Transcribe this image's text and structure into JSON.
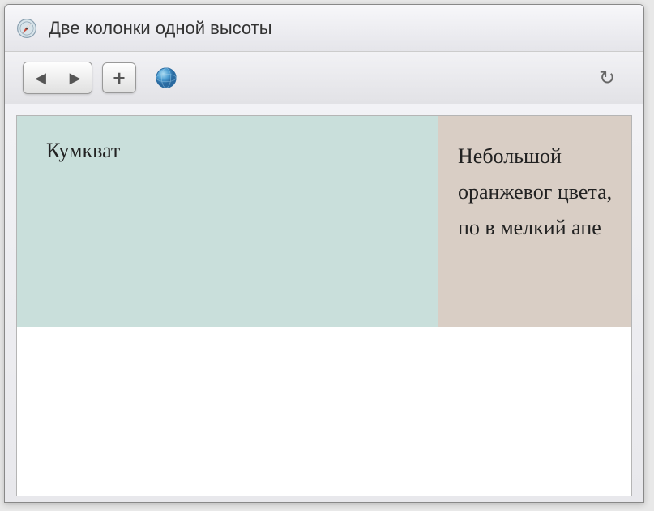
{
  "window": {
    "title": "Две колонки одной высоты"
  },
  "icons": {
    "back": "◀",
    "forward": "▶",
    "add": "+",
    "refresh": "↻"
  },
  "doc": {
    "left_text": "Кумкват",
    "right_text": "Небольшой оранжевог цвета, по в мелкий апе"
  }
}
